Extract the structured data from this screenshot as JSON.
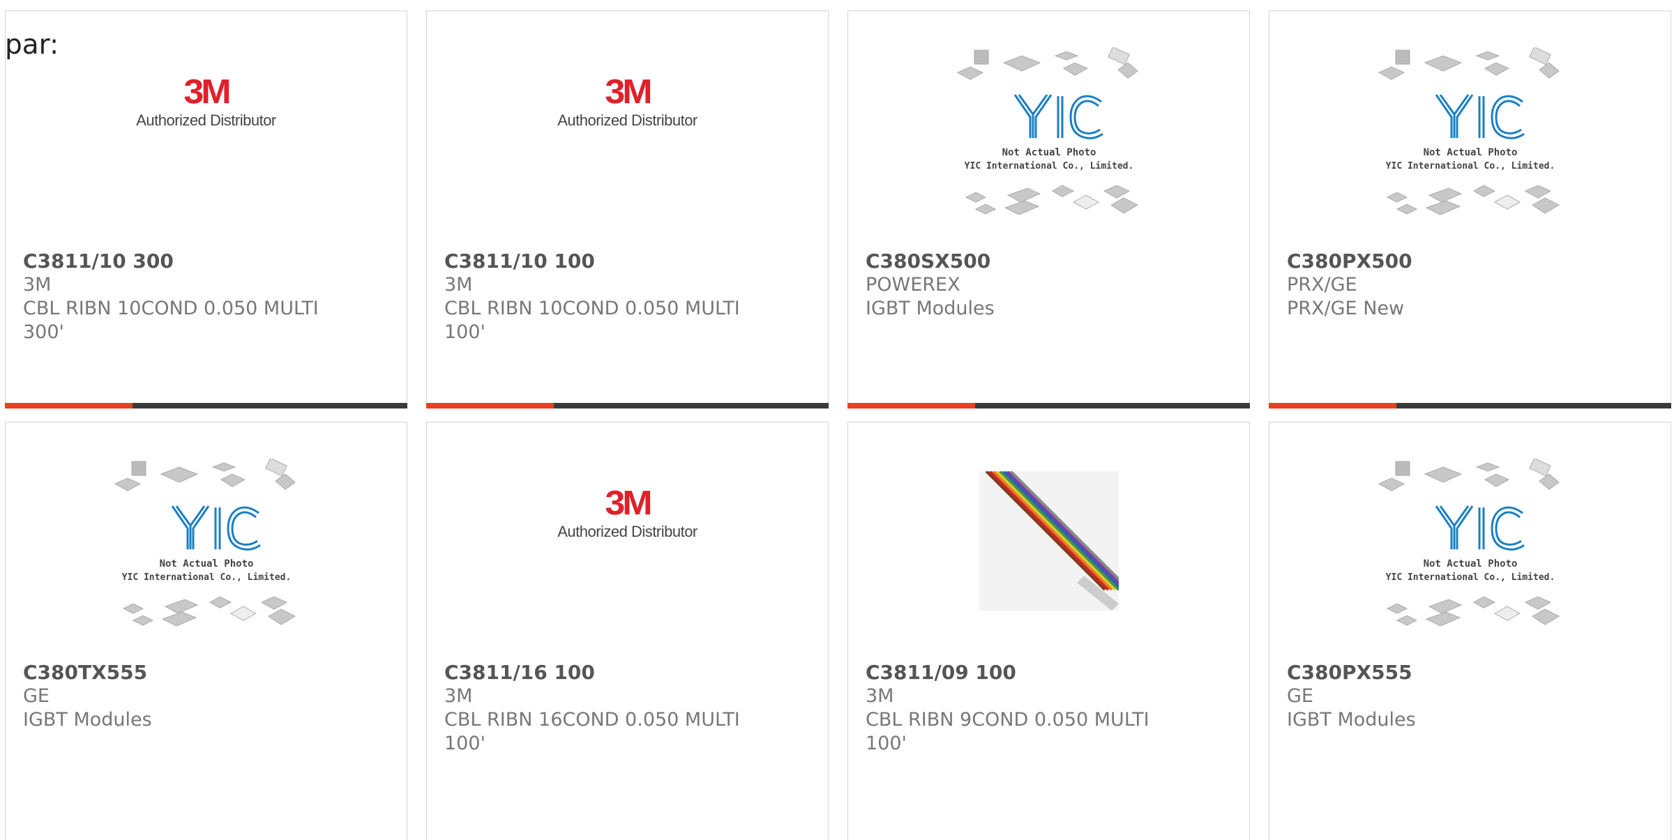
{
  "page": {
    "label": "par:"
  },
  "logos": {
    "brand_3m": {
      "mark": "3M",
      "tagline": "Authorized Distributor"
    },
    "yic": {
      "mark": "YIC",
      "line1": "Not Actual Photo",
      "line2": "YIC International Co., Limited."
    }
  },
  "colors": {
    "accent": "#e8411c",
    "bar": "#3a3a3a",
    "brand_3m_red": "#e0202a",
    "yic_blue": "#1a7fc4"
  },
  "products": [
    {
      "part": "C3811/10 300",
      "mfr": "3M",
      "desc": "CBL RIBN 10COND 0.050 MULTI 300'",
      "image": "3m-logo"
    },
    {
      "part": "C3811/10 100",
      "mfr": "3M",
      "desc": "CBL RIBN 10COND 0.050 MULTI 100'",
      "image": "3m-logo"
    },
    {
      "part": "C380SX500",
      "mfr": "POWEREX",
      "desc": "IGBT Modules",
      "image": "yic-placeholder"
    },
    {
      "part": "C380PX500",
      "mfr": "PRX/GE",
      "desc": "PRX/GE New",
      "image": "yic-placeholder"
    },
    {
      "part": "C380TX555",
      "mfr": "GE",
      "desc": "IGBT Modules",
      "image": "yic-placeholder"
    },
    {
      "part": "C3811/16 100",
      "mfr": "3M",
      "desc": "CBL RIBN 16COND 0.050 MULTI 100'",
      "image": "3m-logo"
    },
    {
      "part": "C3811/09 100",
      "mfr": "3M",
      "desc": "CBL RIBN 9COND 0.050 MULTI 100'",
      "image": "ribbon-cable-photo"
    },
    {
      "part": "C380PX555",
      "mfr": "GE",
      "desc": "IGBT Modules",
      "image": "yic-placeholder"
    }
  ]
}
